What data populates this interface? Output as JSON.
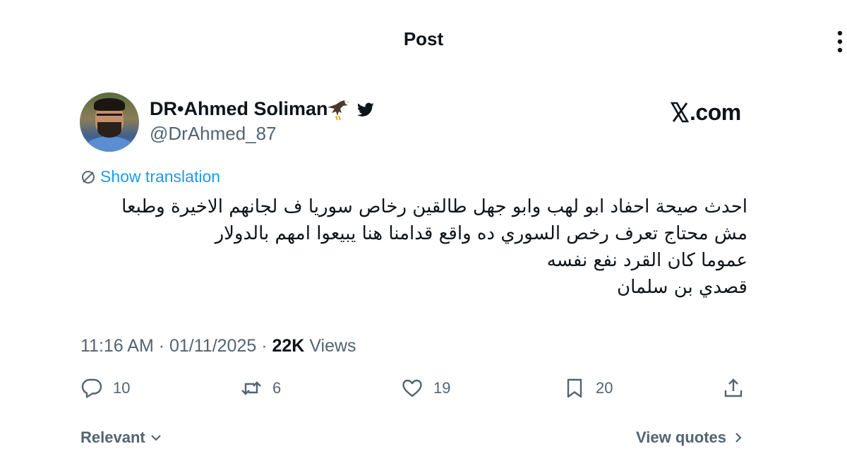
{
  "header": {
    "title": "Post",
    "more_icon": "more-vertical-icon"
  },
  "author": {
    "display_name": "DR•Ahmed Soliman",
    "handle": "@DrAhmed_87",
    "badges": [
      "eagle-emoji-icon",
      "twitter-bird-icon"
    ],
    "avatar": "profile-photo"
  },
  "watermark": {
    "site": ".com",
    "logo_icon": "x-logo-icon"
  },
  "translation": {
    "label": "Show translation",
    "icon": "globe-translate-icon"
  },
  "tweet": {
    "lines": [
      "احدث صيحة احفاد ابو لهب وابو جهل طالقين رخاص سوريا ف لجانهم الاخيرة وطبعا",
      "مش محتاج تعرف رخص السوري ده واقع قدامنا هنا يبيعوا امهم بالدولار",
      "عموما كان القرد نفع نفسه",
      "قصدي بن سلمان"
    ]
  },
  "meta": {
    "time": "11:16 AM",
    "separator1": " · ",
    "date": "01/11/2025",
    "separator2": " · ",
    "views_count": "22K",
    "views_label": " Views"
  },
  "actions": {
    "replies": "10",
    "reposts": "6",
    "likes": "19",
    "bookmarks": "20",
    "icons": [
      "reply-icon",
      "repost-icon",
      "like-icon",
      "bookmark-icon",
      "share-icon"
    ]
  },
  "footer": {
    "sort_label": "Relevant",
    "quotes_label": "View quotes"
  },
  "colors": {
    "text": "#0f1419",
    "secondary": "#536471",
    "link": "#1d9bf0",
    "background": "#ffffff"
  }
}
